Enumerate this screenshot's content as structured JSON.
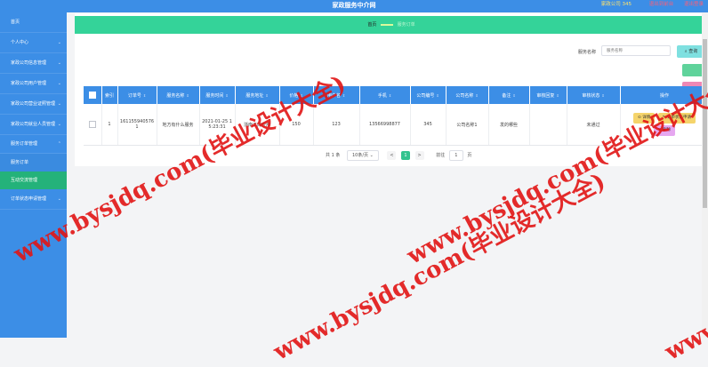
{
  "header": {
    "title": "家政服务中介网",
    "company": "家政公司 345",
    "link1": "退出到前台",
    "link2": "退出登录"
  },
  "sidebar": {
    "items": [
      {
        "label": "首页",
        "chevron": ""
      },
      {
        "label": "个人中心",
        "chevron": "⌄"
      },
      {
        "label": "家政公司信息管理",
        "chevron": "⌄"
      },
      {
        "label": "家政公司用户管理",
        "chevron": "⌄"
      },
      {
        "label": "家政公司营业证照管理",
        "chevron": "⌄"
      },
      {
        "label": "家政公司就业人员管理",
        "chevron": "⌄"
      }
    ],
    "order_group": {
      "label": "服务订单管理",
      "chevron": "⌃"
    },
    "sub_items": [
      {
        "label": "服务订单"
      },
      {
        "label": "互动交流管理"
      }
    ],
    "last_item": {
      "label": "订单状态申请管理",
      "chevron": "⌄"
    }
  },
  "breadcrumb": {
    "home": "首页",
    "current": "服务订单"
  },
  "search": {
    "label": "服务名称",
    "placeholder": "服务名称",
    "button": "查询"
  },
  "table": {
    "headers": [
      "索引",
      "订单号",
      "服务名称",
      "服务时间",
      "服务地址",
      "价格",
      "用户名",
      "手机",
      "公司编号",
      "公司名称",
      "备注",
      "审核回复",
      "审核状态",
      "操作"
    ],
    "rows": [
      {
        "index": "1",
        "order_no": "1611559405761",
        "service_name": "地方有什么服务",
        "service_time": "2021-01-25 15:23:31",
        "address": "浙南工商应用",
        "price": "150",
        "username": "123",
        "phone": "13566998877",
        "company_no": "345",
        "company_name": "公司名称1",
        "remark": "发的哪些",
        "reply": "",
        "status": "未通过",
        "actions": {
          "detail": "详情",
          "apply": "订单状态申请",
          "delete": "删除"
        }
      }
    ]
  },
  "pagination": {
    "total": "共 1 条",
    "size": "10条/页",
    "prev": "<",
    "page": "1",
    "next": ">",
    "goto": "前往",
    "goto_value": "1",
    "unit": "页"
  },
  "watermark": "www.bysjdq.com(毕业设计大全)",
  "colors": {
    "primary": "#3c8ee6",
    "breadcrumb": "#34d399",
    "active_sub": "#24b27a",
    "watermark": "#e11414"
  }
}
